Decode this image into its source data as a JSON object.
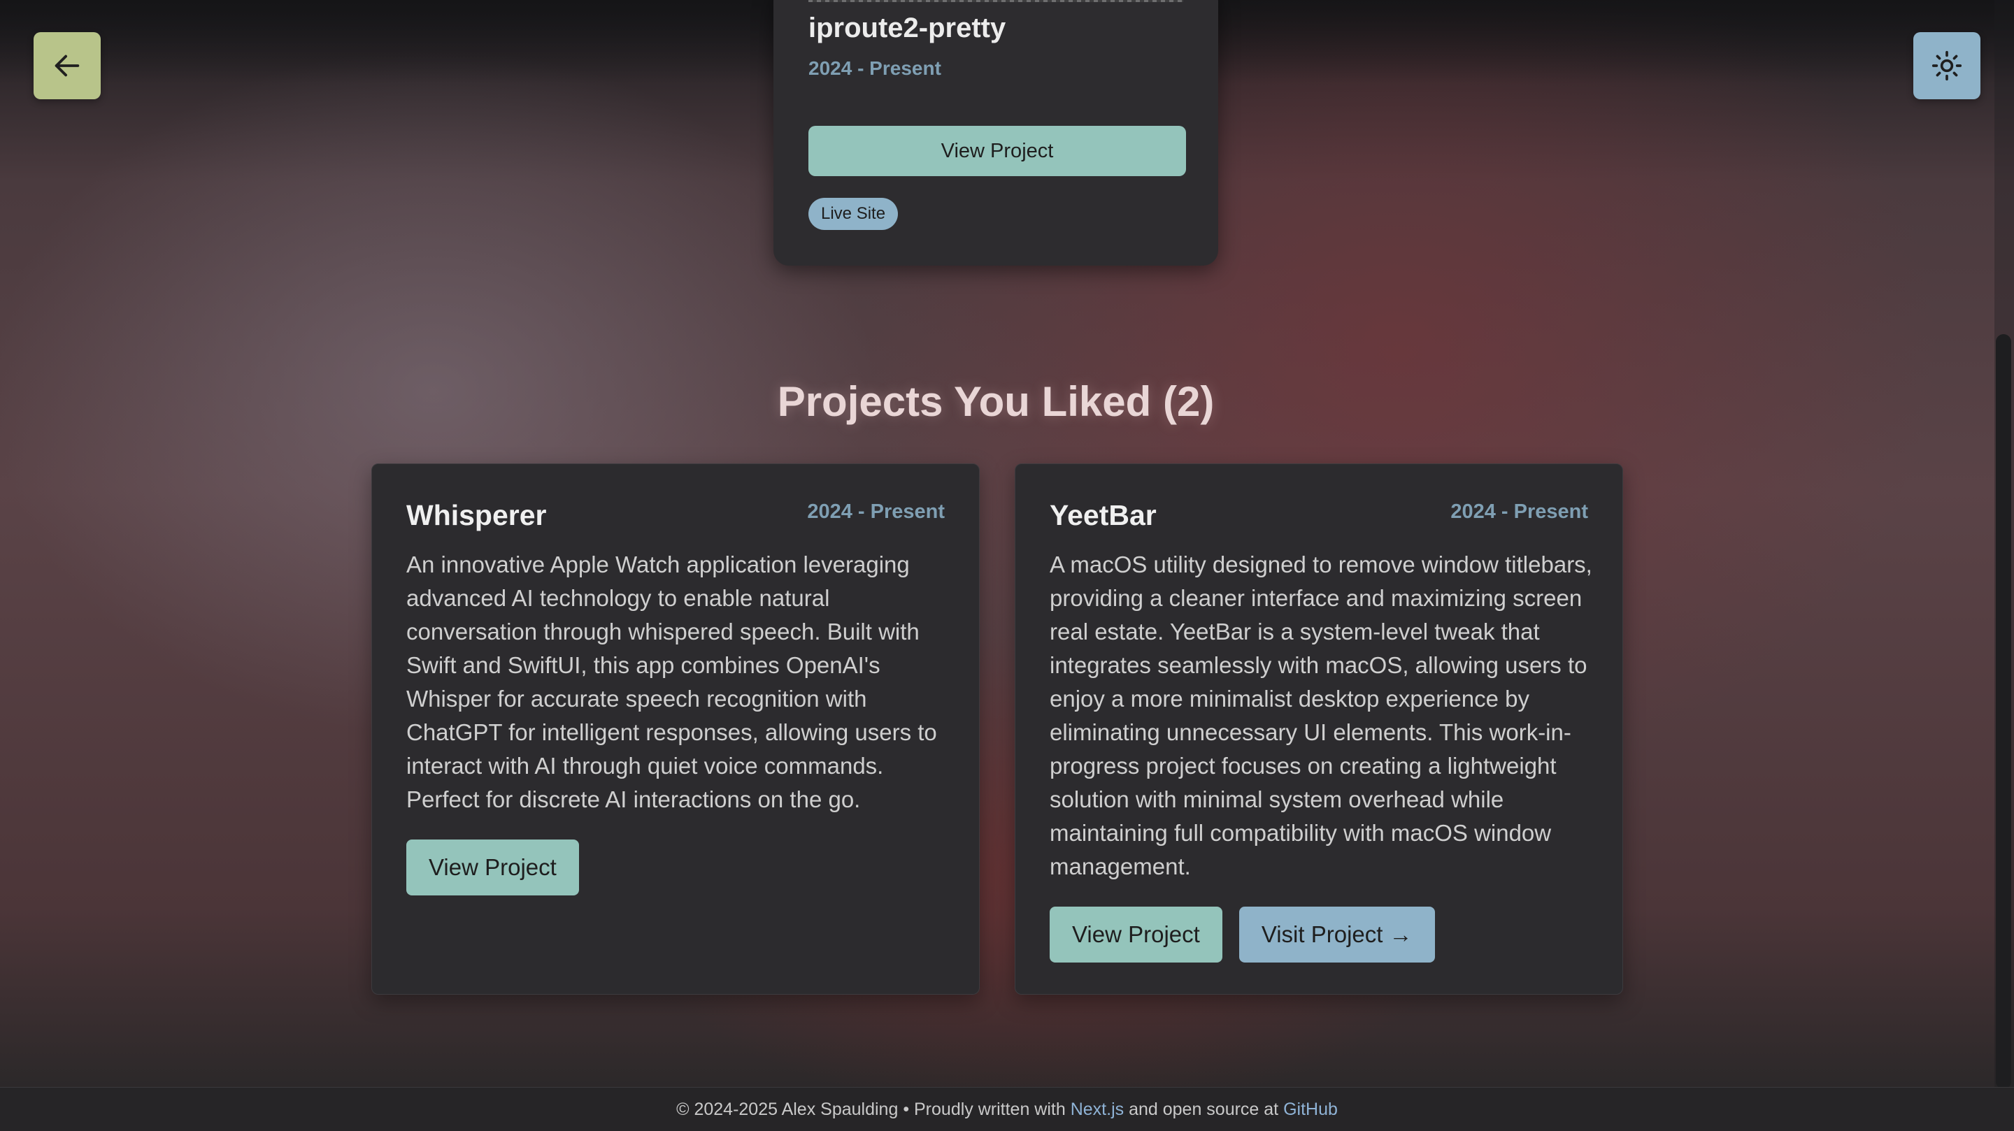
{
  "top_project": {
    "title": "iproute2-pretty",
    "date": "2024 - Present",
    "view_label": "View Project",
    "badge": "Live Site"
  },
  "header": {
    "back_icon": "arrow-left-icon",
    "theme_icon": "sun-icon"
  },
  "liked": {
    "title": "Projects You Liked (2)",
    "cards": [
      {
        "title": "Whisperer",
        "date": "2024 - Present",
        "description": "An innovative Apple Watch application leveraging advanced AI technology to enable natural conversation through whispered speech. Built with Swift and SwiftUI, this app combines OpenAI's Whisper for accurate speech recognition with ChatGPT for intelligent responses, allowing users to interact with AI through quiet voice commands. Perfect for discrete AI interactions on the go.",
        "view_label": "View Project"
      },
      {
        "title": "YeetBar",
        "date": "2024 - Present",
        "description": "A macOS utility designed to remove window titlebars, providing a cleaner interface and maximizing screen real estate. YeetBar is a system-level tweak that integrates seamlessly with macOS, allowing users to enjoy a more minimalist desktop experience by eliminating unnecessary UI elements. This work-in-progress project focuses on creating a lightweight solution with minimal system overhead while maintaining full compatibility with macOS window management.",
        "view_label": "View Project",
        "visit_label": "Visit Project →"
      }
    ]
  },
  "footer": {
    "prefix": "© 2024-2025 Alex Spaulding • Proudly written with ",
    "nextjs_link": "Next.js",
    "middle": " and open source at ",
    "github_link": "GitHub"
  },
  "colors": {
    "accent_teal": "#94c4bb",
    "accent_blue": "#8fb3c9",
    "accent_olive": "#b8c48a",
    "date_blue": "#7f9fb3",
    "link_blue": "#8fb3d6"
  }
}
